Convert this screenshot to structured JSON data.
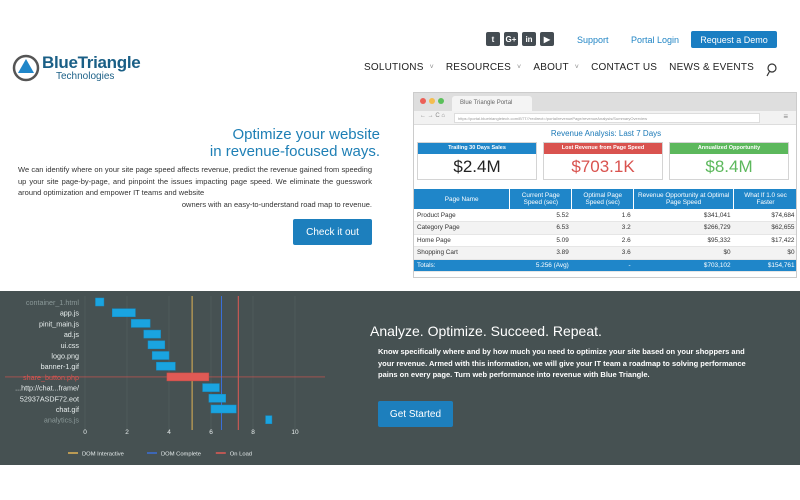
{
  "brand": {
    "name": "BlueTriangle",
    "sub": "Technologies"
  },
  "header": {
    "social": [
      {
        "icon": "twitter-icon",
        "glyph": "t"
      },
      {
        "icon": "googleplus-icon",
        "glyph": "G+"
      },
      {
        "icon": "linkedin-icon",
        "glyph": "in"
      },
      {
        "icon": "youtube-icon",
        "glyph": "▶"
      }
    ],
    "support": "Support",
    "portal_login": "Portal Login",
    "demo": "Request a Demo",
    "nav": [
      "SOLUTIONS",
      "RESOURCES",
      "ABOUT",
      "CONTACT US",
      "NEWS & EVENTS"
    ]
  },
  "hero": {
    "title_line1": "Optimize your website",
    "title_line2": "in revenue-focused ways.",
    "description": "We can identify where on your site page speed affects revenue, predict the revenue gained from speeding up your site page-by-page, and pinpoint the issues impacting page speed. We eliminate the guesswork around optimization and empower IT teams and website",
    "description_last": "owners with an easy-to-understand road map to revenue.",
    "cta": "Check it out"
  },
  "browser": {
    "tab": "Blue Triangle Portal",
    "url": "https://portal.bluetriangletech.com/BTT/?redirect=/portal/revenuePage/revenueAnalysis/SummaryOverview",
    "report_title": "Revenue Analysis: Last 7 Days",
    "kpis": [
      {
        "label": "Trailing 30 Days Sales",
        "value": "$2.4M",
        "head_color": "#1f86c9",
        "value_color": "#222222"
      },
      {
        "label": "Lost Revenue from Page Speed",
        "value": "$703.1K",
        "head_color": "#d9534f",
        "value_color": "#d9534f"
      },
      {
        "label": "Annualized Opportunity",
        "value": "$8.4M",
        "head_color": "#5cb85c",
        "value_color": "#5cb85c"
      }
    ],
    "table": {
      "headers": [
        "Page Name",
        "Current Page Speed (sec)",
        "Optimal Page Speed (sec)",
        "Revenue Opportunity at Optimal Page Speed",
        "What If 1.0 sec Faster"
      ],
      "rows": [
        [
          "Product Page",
          "5.52",
          "1.6",
          "$341,041",
          "$74,684"
        ],
        [
          "Category Page",
          "6.53",
          "3.2",
          "$266,729",
          "$62,655"
        ],
        [
          "Home Page",
          "5.09",
          "2.6",
          "$95,332",
          "$17,422"
        ],
        [
          "Shopping Cart",
          "3.89",
          "3.6",
          "$0",
          "$0"
        ]
      ],
      "total": [
        "Totals:",
        "5.256 (Avg)",
        "-",
        "$703,102",
        "$154,761"
      ]
    }
  },
  "waterfall": {
    "resources": [
      "container_1.html",
      "app.js",
      "pinit_main.js",
      "ad.js",
      "ui.css",
      "logo.png",
      "banner-1.gif",
      "share_button.php",
      "...http://chat...frame/",
      "52937ASDF72.eot",
      "chat.gif",
      "analytics.js"
    ],
    "bars": [
      [
        0.5,
        0.9
      ],
      [
        1.3,
        2.4
      ],
      [
        2.2,
        3.1
      ],
      [
        2.8,
        3.6
      ],
      [
        3.0,
        3.8
      ],
      [
        3.2,
        4.0
      ],
      [
        3.4,
        4.3
      ],
      [
        3.9,
        5.9
      ],
      [
        5.6,
        6.4
      ],
      [
        5.9,
        6.7
      ],
      [
        6.0,
        7.2
      ],
      [
        8.6,
        8.9
      ]
    ],
    "highlight_index": 7,
    "ticks": [
      "0",
      "2",
      "4",
      "6",
      "8",
      "10"
    ],
    "markers": [
      {
        "name": "DOM Interactive",
        "at": 5.1,
        "color": "#e0b355"
      },
      {
        "name": "DOM Complete",
        "at": 6.5,
        "color": "#3a6fd8"
      },
      {
        "name": "On Load",
        "at": 7.3,
        "color": "#e05a55"
      }
    ]
  },
  "band": {
    "title": "Analyze. Optimize. Succeed. Repeat.",
    "description": "Know specifically where and by how much you need to optimize your site based on your shoppers and your revenue. Armed with this information, we will give your IT team a roadmap to solving performance pains on every page. Turn web performance into revenue with Blue Triangle.",
    "cta": "Get Started"
  }
}
